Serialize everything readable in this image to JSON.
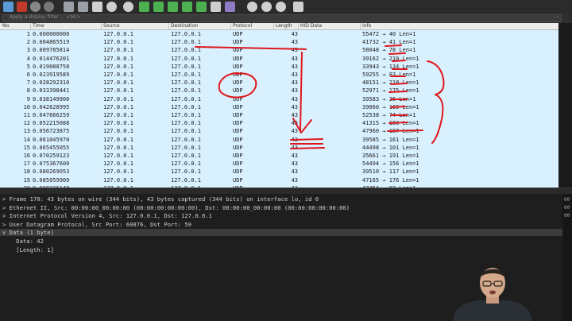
{
  "toolbar": {
    "icons": [
      "close-file-icon",
      "stop-capture-icon",
      "restart-capture-icon",
      "options-gear-icon",
      "open-file-icon",
      "save-file-icon",
      "close-x-icon",
      "reload-icon",
      "find-icon",
      "back-icon",
      "forward-icon",
      "goto-packet-icon",
      "first-packet-icon",
      "last-packet-icon",
      "autoscroll-icon",
      "colorize-icon",
      "zoom-in-icon",
      "zoom-out-icon",
      "normal-size-icon",
      "resize-columns-icon"
    ],
    "colors": {
      "accent_red": "#c0392b",
      "accent_green": "#4caf50",
      "accent_blue": "#5b9bd5"
    }
  },
  "filter": {
    "placeholder": "Apply a display filter … <⌘/>"
  },
  "columns": {
    "no": "No.",
    "time": "Time",
    "source": "Source",
    "destination": "Destination",
    "protocol": "Protocol",
    "length": "Length",
    "hid_data": "HID Data",
    "info": "Info"
  },
  "packets": [
    {
      "no": "1",
      "time": "0.000000000",
      "src": "127.0.0.1",
      "dst": "127.0.0.1",
      "proto": "UDP",
      "len": "43",
      "info": "55472 → 40 Len=1"
    },
    {
      "no": "2",
      "time": "0.004865519",
      "src": "127.0.0.1",
      "dst": "127.0.0.1",
      "proto": "UDP",
      "len": "43",
      "info": "41732 → 41 Len=1"
    },
    {
      "no": "3",
      "time": "0.009785814",
      "src": "127.0.0.1",
      "dst": "127.0.0.1",
      "proto": "UDP",
      "len": "43",
      "info": "58048 → 78 Len=1"
    },
    {
      "no": "4",
      "time": "0.014476201",
      "src": "127.0.0.1",
      "dst": "127.0.0.1",
      "proto": "UDP",
      "len": "43",
      "info": "39162 → 210 Len=1"
    },
    {
      "no": "5",
      "time": "0.019088758",
      "src": "127.0.0.1",
      "dst": "127.0.0.1",
      "proto": "UDP",
      "len": "43",
      "info": "33943 → 134 Len=1"
    },
    {
      "no": "6",
      "time": "0.023919589",
      "src": "127.0.0.1",
      "dst": "127.0.0.1",
      "proto": "UDP",
      "len": "43",
      "info": "59255 → 83 Len=1"
    },
    {
      "no": "7",
      "time": "0.028292310",
      "src": "127.0.0.1",
      "dst": "127.0.0.1",
      "proto": "UDP",
      "len": "43",
      "info": "48151 → 218 Len=1"
    },
    {
      "no": "8",
      "time": "0.033398441",
      "src": "127.0.0.1",
      "dst": "127.0.0.1",
      "proto": "UDP",
      "len": "43",
      "info": "52971 → 175 Len=1"
    },
    {
      "no": "9",
      "time": "0.038149900",
      "src": "127.0.0.1",
      "dst": "127.0.0.1",
      "proto": "UDP",
      "len": "43",
      "info": "39583 → 26 Len=1"
    },
    {
      "no": "10",
      "time": "0.042628995",
      "src": "127.0.0.1",
      "dst": "127.0.0.1",
      "proto": "UDP",
      "len": "43",
      "info": "39060 → 165 Len=1"
    },
    {
      "no": "11",
      "time": "0.047666259",
      "src": "127.0.0.1",
      "dst": "127.0.0.1",
      "proto": "UDP",
      "len": "43",
      "info": "52538 → 74 Len=1"
    },
    {
      "no": "12",
      "time": "0.052215088",
      "src": "127.0.0.1",
      "dst": "127.0.0.1",
      "proto": "UDP",
      "len": "43",
      "info": "41315 → 166 Len=1"
    },
    {
      "no": "13",
      "time": "0.056723875",
      "src": "127.0.0.1",
      "dst": "127.0.0.1",
      "proto": "UDP",
      "len": "43",
      "info": "47960 → 187 Len=1"
    },
    {
      "no": "14",
      "time": "0.061045970",
      "src": "127.0.0.1",
      "dst": "127.0.0.1",
      "proto": "UDP",
      "len": "43",
      "info": "39585 → 161 Len=1"
    },
    {
      "no": "15",
      "time": "0.065455055",
      "src": "127.0.0.1",
      "dst": "127.0.0.1",
      "proto": "UDP",
      "len": "43",
      "info": "44498 → 101 Len=1"
    },
    {
      "no": "16",
      "time": "0.070259123",
      "src": "127.0.0.1",
      "dst": "127.0.0.1",
      "proto": "UDP",
      "len": "43",
      "info": "35661 → 191 Len=1"
    },
    {
      "no": "17",
      "time": "0.075367600",
      "src": "127.0.0.1",
      "dst": "127.0.0.1",
      "proto": "UDP",
      "len": "43",
      "info": "54494 → 156 Len=1"
    },
    {
      "no": "18",
      "time": "0.080269053",
      "src": "127.0.0.1",
      "dst": "127.0.0.1",
      "proto": "UDP",
      "len": "43",
      "info": "39510 → 117 Len=1"
    },
    {
      "no": "19",
      "time": "0.085059909",
      "src": "127.0.0.1",
      "dst": "127.0.0.1",
      "proto": "UDP",
      "len": "43",
      "info": "47165 → 176 Len=1"
    },
    {
      "no": "20",
      "time": "0.090236149",
      "src": "127.0.0.1",
      "dst": "127.0.0.1",
      "proto": "UDP",
      "len": "43",
      "info": "47454 → 82 Len=1"
    }
  ],
  "details": [
    "> Frame 170: 43 bytes on wire (344 bits), 43 bytes captured (344 bits) on interface lo, id 0",
    "> Ethernet II, Src: 00:00:00_00:00:00 (00:00:00:00:00:00), Dst: 00:00:00_00:00:00 (00:00:00:00:00:00)",
    "> Internet Protocol Version 4, Src: 127.0.0.1, Dst: 127.0.0.1",
    "> User Datagram Protocol, Src Port: 60876, Dst Port: 59",
    "v Data (1 byte)",
    "    Data: 42",
    "    [Length: 1]"
  ],
  "hexpane": [
    "00",
    "00",
    "00"
  ],
  "annotation_color": "#e0161c",
  "row_background": "#d9f1ff"
}
